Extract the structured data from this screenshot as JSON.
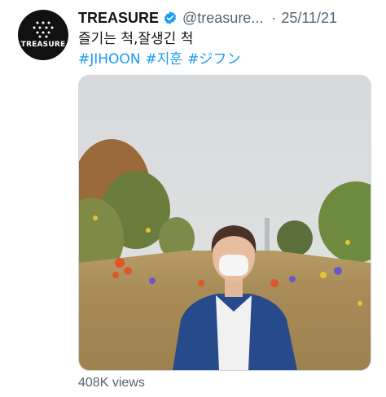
{
  "account": {
    "display_name": "TREASURE",
    "handle": "@treasure...",
    "date": "25/11/21",
    "separator": "·",
    "avatar_label": "TREASURE"
  },
  "tweet": {
    "text": "즐기는 척,잘생긴 척",
    "hashtags": [
      "#JIHOON",
      "#지훈",
      "#ジフン"
    ]
  },
  "media": {
    "type": "video"
  },
  "stats": {
    "views": "408K views"
  },
  "colors": {
    "link": "#1d9bf0",
    "verified": "#1d9bf0",
    "secondary_text": "#536471"
  },
  "icons": {
    "verified": "verified-badge-icon"
  }
}
